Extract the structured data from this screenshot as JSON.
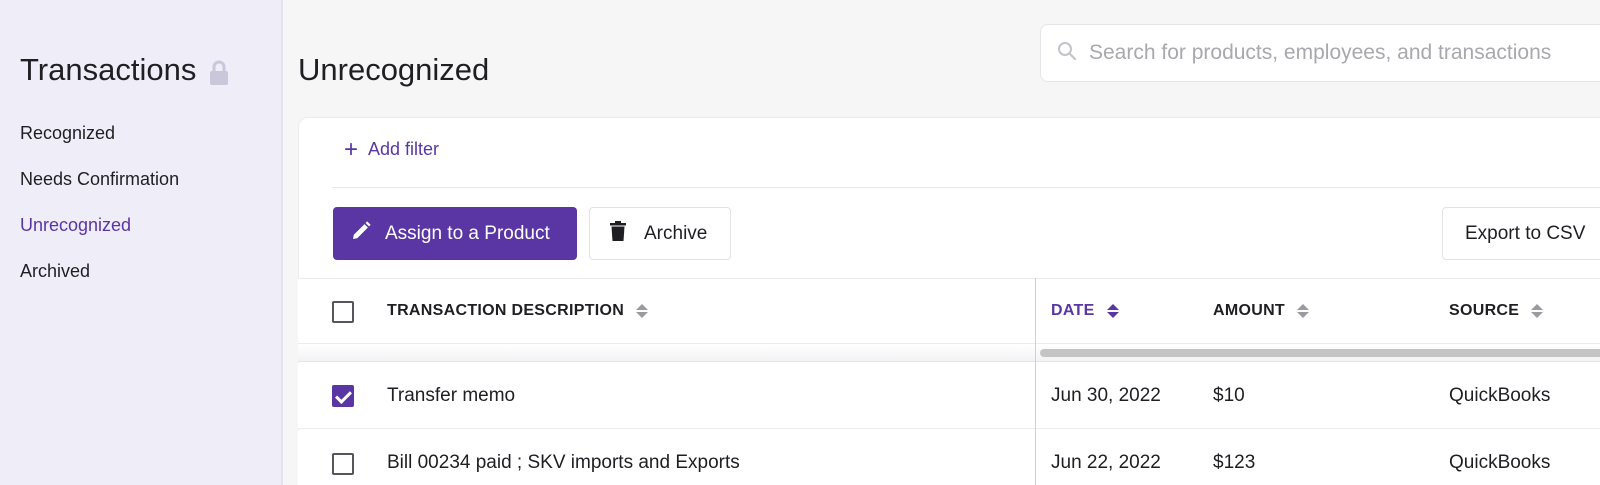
{
  "sidebar": {
    "title": "Transactions",
    "title_icon": "lock-icon",
    "items": [
      {
        "label": "Recognized",
        "active": false
      },
      {
        "label": "Needs Confirmation",
        "active": false
      },
      {
        "label": "Unrecognized",
        "active": true
      },
      {
        "label": "Archived",
        "active": false
      }
    ]
  },
  "main": {
    "title": "Unrecognized",
    "search": {
      "placeholder": "Search for products, employees, and transactions",
      "icon": "search-icon"
    },
    "add_filter_label": "Add filter",
    "toolbar": {
      "assign_label": "Assign to a Product",
      "assign_icon": "pencil-icon",
      "archive_label": "Archive",
      "archive_icon": "trash-icon",
      "export_label": "Export to CSV"
    },
    "table": {
      "columns": [
        "TRANSACTION DESCRIPTION",
        "DATE",
        "AMOUNT",
        "SOURCE"
      ],
      "active_sort_column": "DATE",
      "rows": [
        {
          "checked": true,
          "description": "Transfer memo",
          "date": "Jun 30, 2022",
          "amount": "$10",
          "source": "QuickBooks"
        },
        {
          "checked": false,
          "description": "Bill 00234 paid ; SKV imports and Exports",
          "date": "Jun 22, 2022",
          "amount": "$123",
          "source": "QuickBooks"
        }
      ]
    }
  },
  "colors": {
    "accent": "#5a36a4",
    "sidebar_bg": "#efedf8",
    "page_bg": "#f6f6f7"
  }
}
